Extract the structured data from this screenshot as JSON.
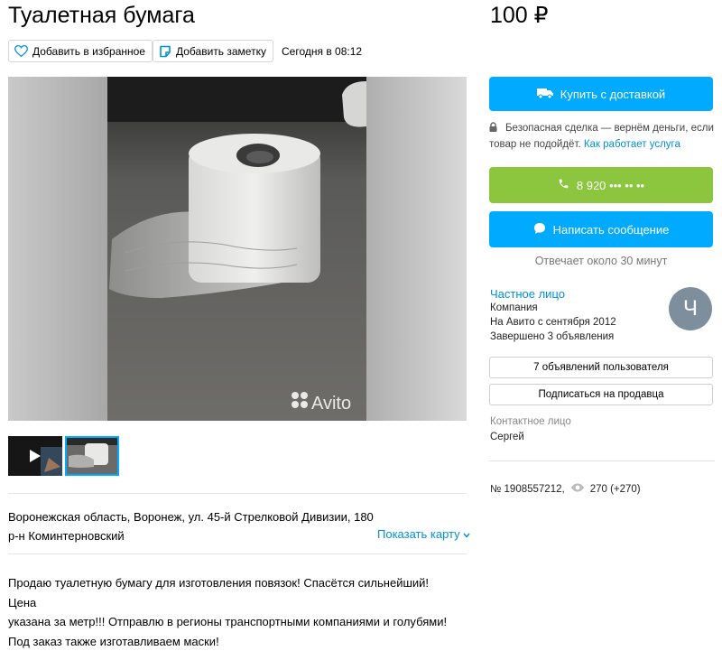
{
  "listing": {
    "title": "Туалетная бумага",
    "price": "100 ₽",
    "date": "Сегодня в 08:12",
    "favorite_label": "Добавить в избранное",
    "note_label": "Добавить заметку",
    "watermark": "Avito",
    "address_line1": "Воронежская область, Воронеж, ул. 45-й Стрелковой Дивизии, 180",
    "address_line2": "р-н Коминтерновский",
    "show_map_label": "Показать карту",
    "description": [
      "Продаю туалетную бумагу для изготовления повязок! Спасётся сильнейший! Цена",
      "указана за метр!!! Отправлю в регионы транспортными компаниями и голубями!",
      "Под заказ также изготавливаем маски!"
    ]
  },
  "sidebar": {
    "buy_label": "Купить с доставкой",
    "safe_text": "Безопасная сделка — вернём деньги, если товар не подойдёт.",
    "safe_link": "Как работает услуга",
    "phone_label": "8 920 ••• •• ••",
    "message_label": "Написать сообщение",
    "reply_time": "Отвечает около 30 минут",
    "seller": {
      "name": "Частное лицо",
      "type": "Компания",
      "since": "На Авито с сентября 2012",
      "completed": "Завершено 3 объявления",
      "avatar_letter": "Ч"
    },
    "user_ads_label": "7 объявлений пользователя",
    "subscribe_label": "Подписаться на продавца",
    "contact_label": "Контактное лицо",
    "contact_name": "Сергей",
    "ad_number": "№ 1908557212,",
    "views": "270 (+270)"
  },
  "colors": {
    "accent_blue": "#00aaff",
    "call_green": "#8cc63f",
    "link_blue": "#0091d9"
  },
  "icons": [
    "heart-icon",
    "note-icon",
    "truck-icon",
    "lock-icon",
    "phone-icon",
    "chat-icon",
    "chevron-down-icon",
    "eye-icon",
    "play-icon"
  ]
}
